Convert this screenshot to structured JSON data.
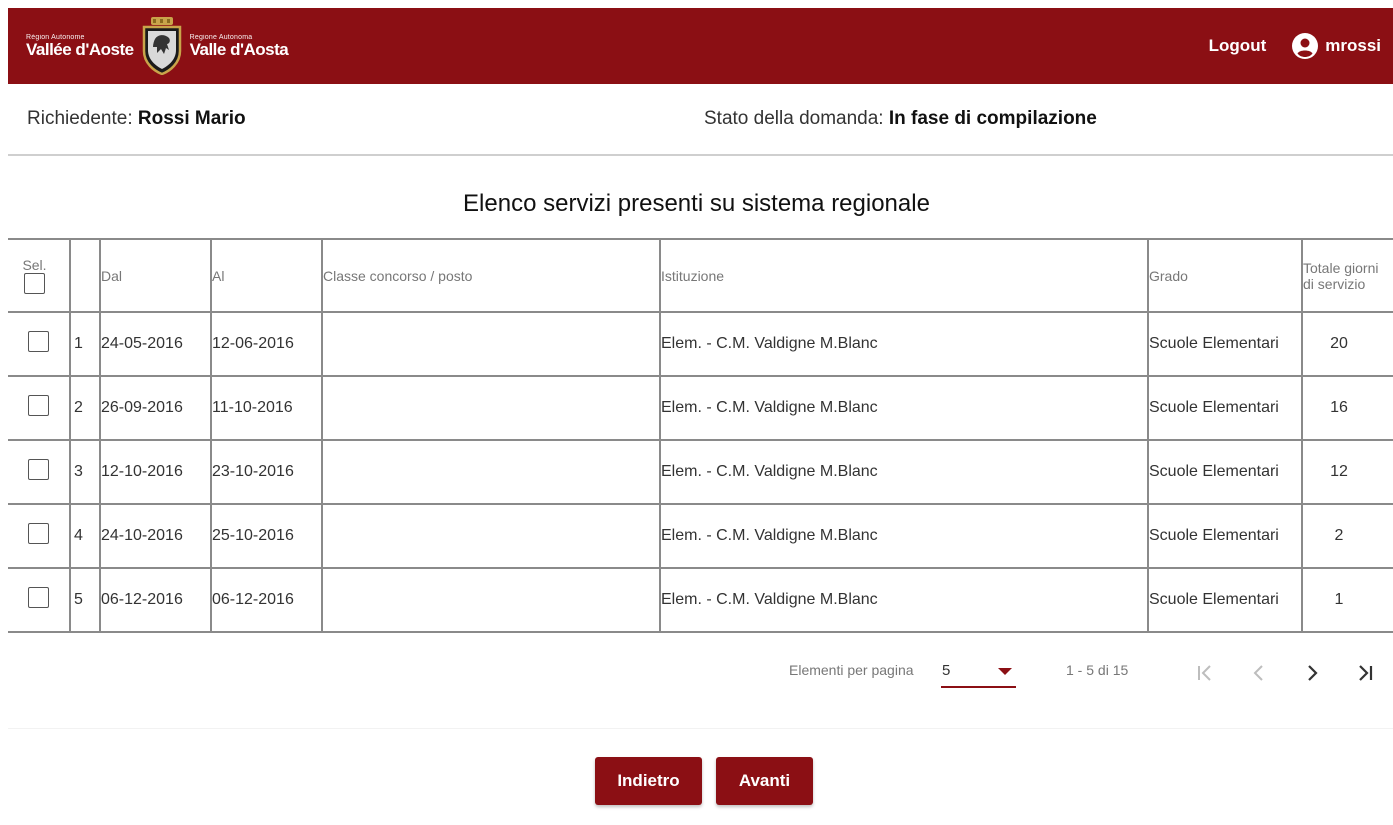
{
  "header": {
    "logo_left_small": "Région Autonome",
    "logo_left_big": "Vallée d'Aoste",
    "logo_right_small": "Regione Autonoma",
    "logo_right_big": "Valle d'Aosta",
    "logout_label": "Logout",
    "username": "mrossi"
  },
  "info": {
    "requester_label": "Richiedente: ",
    "requester_value": "Rossi Mario",
    "status_label": "Stato della domanda: ",
    "status_value": "In fase di compilazione"
  },
  "page_title": "Elenco servizi presenti su sistema regionale",
  "table": {
    "headers": {
      "sel": "Sel.",
      "n": "",
      "dal": "Dal",
      "al": "Al",
      "classe": "Classe concorso / posto",
      "istituzione": "Istituzione",
      "grado": "Grado",
      "totale": "Totale giorni di servizio"
    },
    "rows": [
      {
        "n": "1",
        "dal": "24-05-2016",
        "al": "12-06-2016",
        "classe": "",
        "istituzione": "Elem. - C.M. Valdigne M.Blanc",
        "grado": "Scuole Elementari",
        "totale": "20"
      },
      {
        "n": "2",
        "dal": "26-09-2016",
        "al": "11-10-2016",
        "classe": "",
        "istituzione": "Elem. - C.M. Valdigne M.Blanc",
        "grado": "Scuole Elementari",
        "totale": "16"
      },
      {
        "n": "3",
        "dal": "12-10-2016",
        "al": "23-10-2016",
        "classe": "",
        "istituzione": "Elem. - C.M. Valdigne M.Blanc",
        "grado": "Scuole Elementari",
        "totale": "12"
      },
      {
        "n": "4",
        "dal": "24-10-2016",
        "al": "25-10-2016",
        "classe": "",
        "istituzione": "Elem. - C.M. Valdigne M.Blanc",
        "grado": "Scuole Elementari",
        "totale": "2"
      },
      {
        "n": "5",
        "dal": "06-12-2016",
        "al": "06-12-2016",
        "classe": "",
        "istituzione": "Elem. - C.M. Valdigne M.Blanc",
        "grado": "Scuole Elementari",
        "totale": "1"
      }
    ]
  },
  "paginator": {
    "per_page_label": "Elementi per pagina",
    "per_page_value": "5",
    "range_label": "1 - 5 di 15",
    "icons": [
      "first-page-icon",
      "previous-page-icon",
      "next-page-icon",
      "last-page-icon"
    ]
  },
  "buttons": {
    "back_label": "Indietro",
    "next_label": "Avanti"
  },
  "colors": {
    "brand": "#8b0f14",
    "text": "#333333",
    "muted": "#777777",
    "border": "#8a8a8a"
  }
}
